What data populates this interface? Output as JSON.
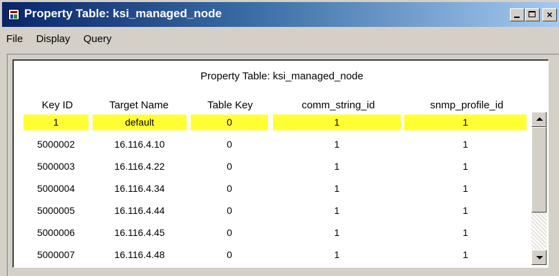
{
  "window": {
    "title": "Property Table: ksi_managed_node",
    "buttons": {
      "minimize": "_",
      "maximize": "□",
      "close": "×"
    }
  },
  "menu": [
    "File",
    "Display",
    "Query"
  ],
  "table": {
    "title": "Property Table: ksi_managed_node",
    "columns": [
      "Key ID",
      "Target Name",
      "Table Key",
      "comm_string_id",
      "snmp_profile_id"
    ],
    "rows": [
      [
        "1",
        "default",
        "0",
        "1",
        "1"
      ],
      [
        "5000002",
        "16.116.4.10",
        "0",
        "1",
        "1"
      ],
      [
        "5000003",
        "16.116.4.22",
        "0",
        "1",
        "1"
      ],
      [
        "5000004",
        "16.116.4.34",
        "0",
        "1",
        "1"
      ],
      [
        "5000005",
        "16.116.4.44",
        "0",
        "1",
        "1"
      ],
      [
        "5000006",
        "16.116.4.45",
        "0",
        "1",
        "1"
      ],
      [
        "5000007",
        "16.116.4.48",
        "0",
        "1",
        "1"
      ]
    ],
    "selected_row": 0
  },
  "colors": {
    "titlebar_start": "#0a246a",
    "titlebar_end": "#a6caf0",
    "selection": "#ffff33",
    "window_bg": "#d4d0c8"
  },
  "icons": {
    "app": "table-icon",
    "scroll_up": "arrow-up-icon",
    "scroll_down": "arrow-down-icon"
  }
}
